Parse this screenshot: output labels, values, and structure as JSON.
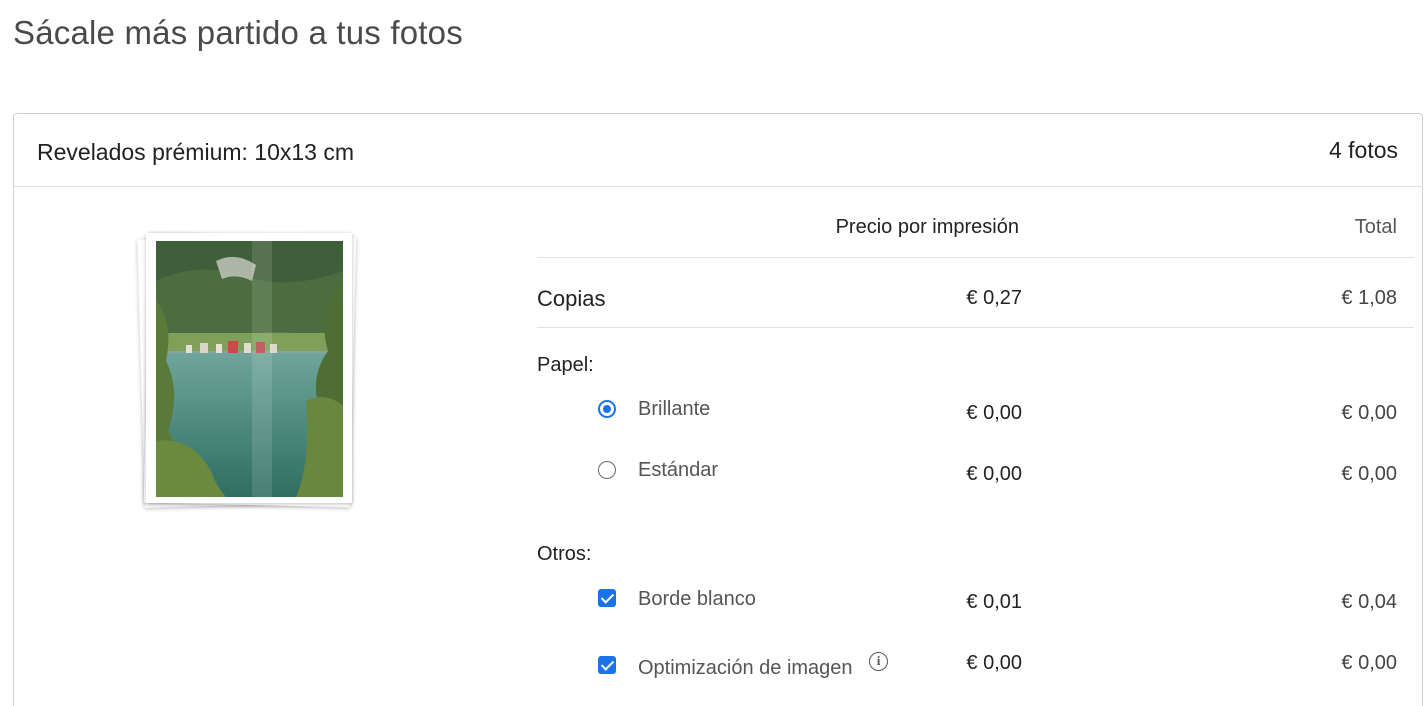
{
  "page": {
    "title": "Sácale más partido a tus fotos"
  },
  "product": {
    "name": "Revelados prémium: 10x13 cm",
    "photo_count": "4 fotos"
  },
  "table": {
    "headers": {
      "price": "Precio por impresión",
      "total": "Total"
    },
    "copies": {
      "label": "Copias",
      "price": "€ 0,27",
      "total": "€ 1,08"
    },
    "paper": {
      "label": "Papel:",
      "options": [
        {
          "label": "Brillante",
          "price": "€ 0,00",
          "total": "€ 0,00",
          "selected": true
        },
        {
          "label": "Estándar",
          "price": "€ 0,00",
          "total": "€ 0,00",
          "selected": false
        }
      ]
    },
    "others": {
      "label": "Otros:",
      "options": [
        {
          "label": "Borde blanco",
          "price": "€ 0,01",
          "total": "€ 0,04",
          "checked": true
        },
        {
          "label": "Optimización de imagen",
          "price": "€ 0,00",
          "total": "€ 0,00",
          "checked": true,
          "icon": "info-icon"
        }
      ]
    }
  },
  "colors": {
    "accent": "#1a73e8",
    "border": "#cfcfcf",
    "divider": "#e2e2e2"
  }
}
